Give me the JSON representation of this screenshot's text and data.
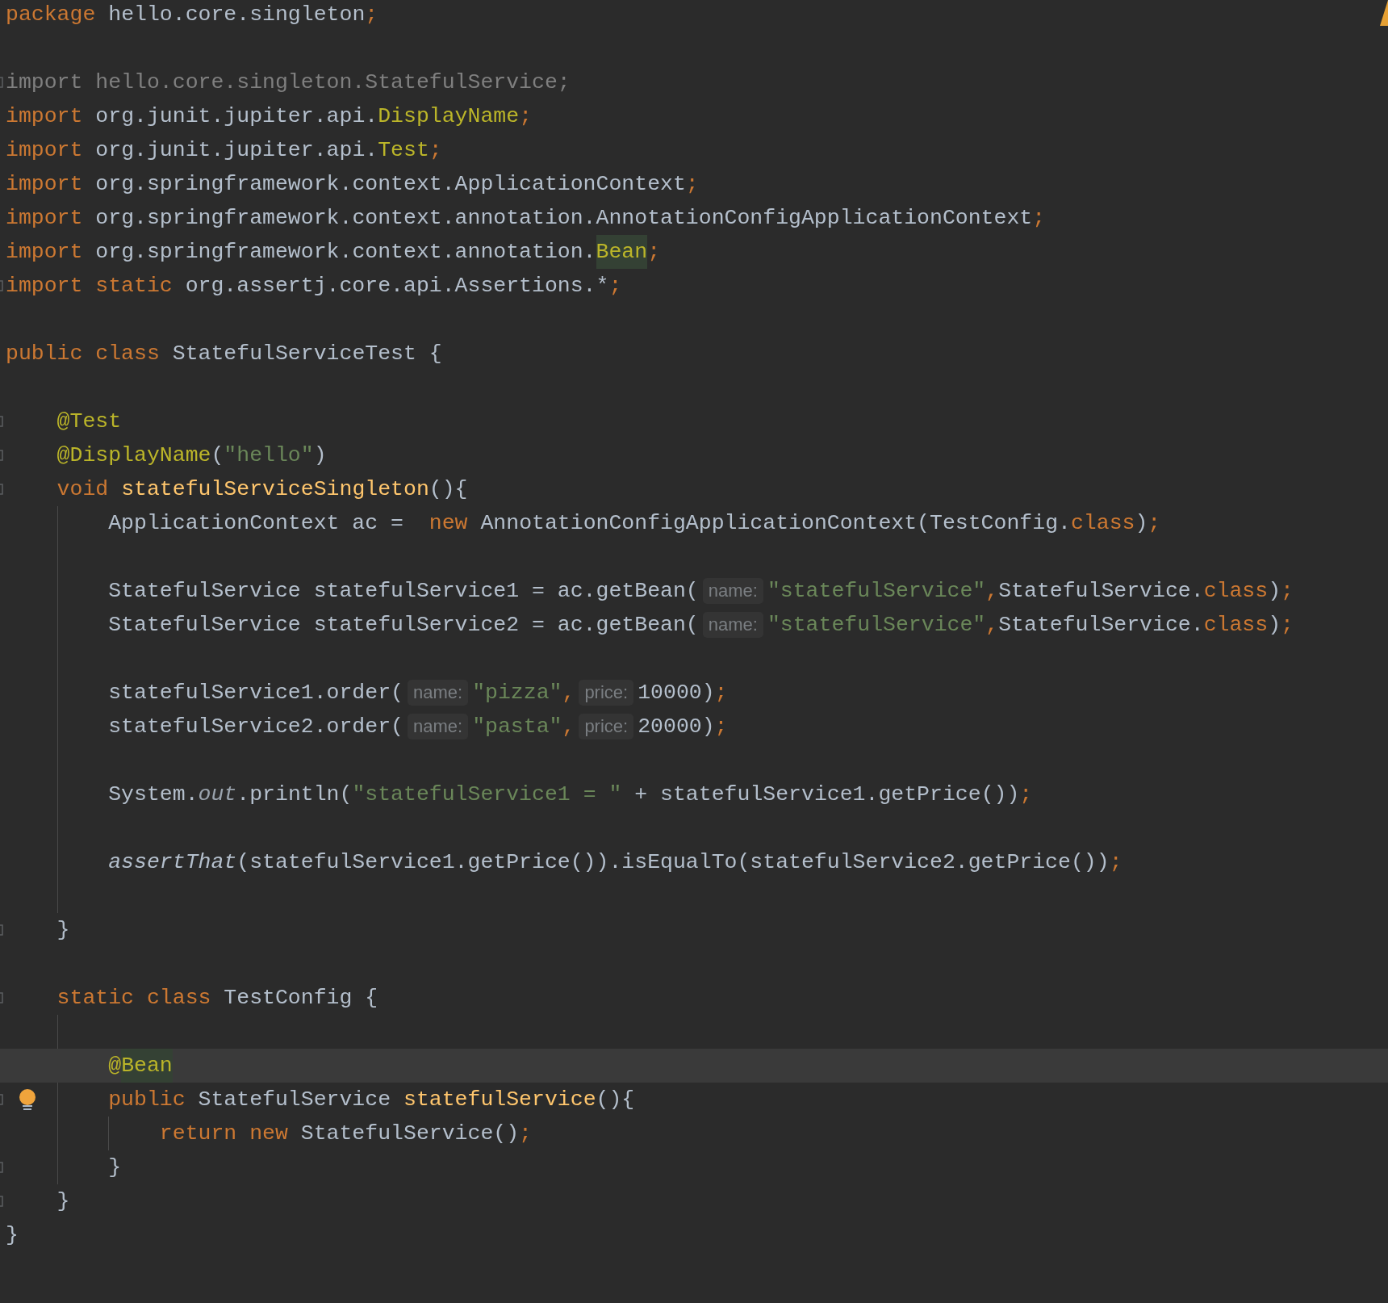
{
  "editor": {
    "warning_marker": true,
    "lines": [
      {
        "fold_marker": false,
        "lightbulb": false,
        "current": false,
        "tokens": [
          {
            "kind": "kw",
            "text": "package"
          },
          {
            "kind": "plain",
            "text": " hello.core.singleton"
          },
          {
            "kind": "kw",
            "text": ";"
          }
        ]
      },
      {
        "fold_marker": false,
        "lightbulb": false,
        "current": false
      },
      {
        "fold_marker": true,
        "lightbulb": false,
        "current": false,
        "tokens": [
          {
            "kind": "unused",
            "text": "import hello.core.singleton.StatefulService;"
          }
        ]
      },
      {
        "fold_marker": false,
        "lightbulb": false,
        "current": false,
        "tokens": [
          {
            "kind": "kw",
            "text": "import"
          },
          {
            "kind": "plain",
            "text": " org.junit.jupiter.api."
          },
          {
            "kind": "ann",
            "text": "DisplayName"
          },
          {
            "kind": "kw",
            "text": ";"
          }
        ]
      },
      {
        "fold_marker": false,
        "lightbulb": false,
        "current": false,
        "tokens": [
          {
            "kind": "kw",
            "text": "import"
          },
          {
            "kind": "plain",
            "text": " org.junit.jupiter.api."
          },
          {
            "kind": "ann",
            "text": "Test"
          },
          {
            "kind": "kw",
            "text": ";"
          }
        ]
      },
      {
        "fold_marker": false,
        "lightbulb": false,
        "current": false,
        "tokens": [
          {
            "kind": "kw",
            "text": "import"
          },
          {
            "kind": "plain",
            "text": " org.springframework.context.ApplicationContext"
          },
          {
            "kind": "kw",
            "text": ";"
          }
        ]
      },
      {
        "fold_marker": false,
        "lightbulb": false,
        "current": false,
        "tokens": [
          {
            "kind": "kw",
            "text": "import"
          },
          {
            "kind": "plain",
            "text": " org.springframework.context.annotation.AnnotationConfigApplicationContext"
          },
          {
            "kind": "kw",
            "text": ";"
          }
        ]
      },
      {
        "fold_marker": false,
        "lightbulb": false,
        "current": false,
        "tokens": [
          {
            "kind": "kw",
            "text": "import"
          },
          {
            "kind": "plain",
            "text": " org.springframework.context.annotation."
          },
          {
            "kind": "ann-hl",
            "text": "Bean"
          },
          {
            "kind": "kw",
            "text": ";"
          }
        ]
      },
      {
        "fold_marker": true,
        "lightbulb": false,
        "current": false,
        "tokens": [
          {
            "kind": "kw",
            "text": "import static"
          },
          {
            "kind": "plain",
            "text": " org.assertj.core.api.Assertions.*"
          },
          {
            "kind": "kw",
            "text": ";"
          }
        ]
      },
      {
        "fold_marker": false,
        "lightbulb": false,
        "current": false
      },
      {
        "fold_marker": false,
        "lightbulb": false,
        "current": false,
        "tokens": [
          {
            "kind": "kw",
            "text": "public class"
          },
          {
            "kind": "plain",
            "text": " StatefulServiceTest {"
          }
        ]
      },
      {
        "fold_marker": false,
        "lightbulb": false,
        "current": false
      },
      {
        "fold_marker": true,
        "lightbulb": false,
        "current": false,
        "indent": [
          false
        ],
        "tokens": [
          {
            "kind": "ann",
            "text": "@Test"
          }
        ]
      },
      {
        "fold_marker": true,
        "lightbulb": false,
        "current": false,
        "indent": [
          false
        ],
        "tokens": [
          {
            "kind": "ann",
            "text": "@DisplayName"
          },
          {
            "kind": "plain",
            "text": "("
          },
          {
            "kind": "str",
            "text": "\"hello\""
          },
          {
            "kind": "plain",
            "text": ")"
          }
        ]
      },
      {
        "fold_marker": true,
        "lightbulb": false,
        "current": false,
        "indent": [
          false
        ],
        "tokens": [
          {
            "kind": "kw",
            "text": "void"
          },
          {
            "kind": "fn",
            "text": " statefulServiceSingleton"
          },
          {
            "kind": "plain",
            "text": "(){"
          }
        ]
      },
      {
        "fold_marker": false,
        "lightbulb": false,
        "current": false,
        "indent": [
          false,
          true
        ],
        "tokens": [
          {
            "kind": "plain",
            "text": "ApplicationContext ac =  "
          },
          {
            "kind": "kw",
            "text": "new"
          },
          {
            "kind": "plain",
            "text": " AnnotationConfigApplicationContext(TestConfig."
          },
          {
            "kind": "kw",
            "text": "class"
          },
          {
            "kind": "plain",
            "text": ")"
          },
          {
            "kind": "kw",
            "text": ";"
          }
        ]
      },
      {
        "fold_marker": false,
        "lightbulb": false,
        "current": false,
        "indent": [
          false,
          true
        ]
      },
      {
        "fold_marker": false,
        "lightbulb": false,
        "current": false,
        "indent": [
          false,
          true
        ],
        "tokens": [
          {
            "kind": "plain",
            "text": "StatefulService statefulService1 = ac.getBean("
          },
          {
            "kind": "hint",
            "text": "name:"
          },
          {
            "kind": "str",
            "text": "\"statefulService\""
          },
          {
            "kind": "kw",
            "text": ","
          },
          {
            "kind": "plain",
            "text": "StatefulService."
          },
          {
            "kind": "kw",
            "text": "class"
          },
          {
            "kind": "plain",
            "text": ")"
          },
          {
            "kind": "kw",
            "text": ";"
          }
        ]
      },
      {
        "fold_marker": false,
        "lightbulb": false,
        "current": false,
        "indent": [
          false,
          true
        ],
        "tokens": [
          {
            "kind": "plain",
            "text": "StatefulService statefulService2 = ac.getBean("
          },
          {
            "kind": "hint",
            "text": "name:"
          },
          {
            "kind": "str",
            "text": "\"statefulService\""
          },
          {
            "kind": "kw",
            "text": ","
          },
          {
            "kind": "plain",
            "text": "StatefulService."
          },
          {
            "kind": "kw",
            "text": "class"
          },
          {
            "kind": "plain",
            "text": ")"
          },
          {
            "kind": "kw",
            "text": ";"
          }
        ]
      },
      {
        "fold_marker": false,
        "lightbulb": false,
        "current": false,
        "indent": [
          false,
          true
        ]
      },
      {
        "fold_marker": false,
        "lightbulb": false,
        "current": false,
        "indent": [
          false,
          true
        ],
        "tokens": [
          {
            "kind": "plain",
            "text": "statefulService1.order("
          },
          {
            "kind": "hint",
            "text": "name:"
          },
          {
            "kind": "str",
            "text": "\"pizza\""
          },
          {
            "kind": "kw",
            "text": ","
          },
          {
            "kind": "hint",
            "text": "price:"
          },
          {
            "kind": "plain",
            "text": "10000)"
          },
          {
            "kind": "kw",
            "text": ";"
          }
        ]
      },
      {
        "fold_marker": false,
        "lightbulb": false,
        "current": false,
        "indent": [
          false,
          true
        ],
        "tokens": [
          {
            "kind": "plain",
            "text": "statefulService2.order("
          },
          {
            "kind": "hint",
            "text": "name:"
          },
          {
            "kind": "str",
            "text": "\"pasta\""
          },
          {
            "kind": "kw",
            "text": ","
          },
          {
            "kind": "hint",
            "text": "price:"
          },
          {
            "kind": "plain",
            "text": "20000)"
          },
          {
            "kind": "kw",
            "text": ";"
          }
        ]
      },
      {
        "fold_marker": false,
        "lightbulb": false,
        "current": false,
        "indent": [
          false,
          true
        ]
      },
      {
        "fold_marker": false,
        "lightbulb": false,
        "current": false,
        "indent": [
          false,
          true
        ],
        "tokens": [
          {
            "kind": "plain",
            "text": "System."
          },
          {
            "kind": "field",
            "text": "out"
          },
          {
            "kind": "plain",
            "text": ".println("
          },
          {
            "kind": "str",
            "text": "\"statefulService1 = \""
          },
          {
            "kind": "plain",
            "text": " + statefulService1.getPrice())"
          },
          {
            "kind": "kw",
            "text": ";"
          }
        ]
      },
      {
        "fold_marker": false,
        "lightbulb": false,
        "current": false,
        "indent": [
          false,
          true
        ]
      },
      {
        "fold_marker": false,
        "lightbulb": false,
        "current": false,
        "indent": [
          false,
          true
        ],
        "tokens": [
          {
            "kind": "italic",
            "text": "assertThat"
          },
          {
            "kind": "plain",
            "text": "(statefulService1.getPrice()).isEqualTo(statefulService2.getPrice())"
          },
          {
            "kind": "kw",
            "text": ";"
          }
        ]
      },
      {
        "fold_marker": false,
        "lightbulb": false,
        "current": false,
        "indent": [
          false,
          true
        ]
      },
      {
        "fold_marker": true,
        "lightbulb": false,
        "current": false,
        "indent": [
          false
        ],
        "tokens": [
          {
            "kind": "plain",
            "text": "}"
          }
        ]
      },
      {
        "fold_marker": false,
        "lightbulb": false,
        "current": false
      },
      {
        "fold_marker": true,
        "lightbulb": false,
        "current": false,
        "indent": [
          false
        ],
        "tokens": [
          {
            "kind": "kw",
            "text": "static class"
          },
          {
            "kind": "plain",
            "text": " TestConfig {"
          }
        ]
      },
      {
        "fold_marker": false,
        "lightbulb": false,
        "current": false,
        "indent": [
          false,
          true
        ]
      },
      {
        "fold_marker": false,
        "lightbulb": false,
        "current": true,
        "indent": [
          false,
          false
        ],
        "tokens": [
          {
            "kind": "ann",
            "text": "@"
          },
          {
            "kind": "ann-hl",
            "text": "Bean"
          }
        ]
      },
      {
        "fold_marker": true,
        "lightbulb": true,
        "current": false,
        "indent": [
          false,
          true
        ],
        "tokens": [
          {
            "kind": "kw",
            "text": "public"
          },
          {
            "kind": "plain",
            "text": " StatefulService "
          },
          {
            "kind": "fn",
            "text": "statefulService"
          },
          {
            "kind": "plain",
            "text": "(){"
          }
        ]
      },
      {
        "fold_marker": false,
        "lightbulb": false,
        "current": false,
        "indent": [
          false,
          true,
          true
        ],
        "tokens": [
          {
            "kind": "kw",
            "text": "return new"
          },
          {
            "kind": "plain",
            "text": " StatefulService()"
          },
          {
            "kind": "kw",
            "text": ";"
          }
        ]
      },
      {
        "fold_marker": true,
        "lightbulb": false,
        "current": false,
        "indent": [
          false,
          true
        ],
        "tokens": [
          {
            "kind": "plain",
            "text": "}"
          }
        ]
      },
      {
        "fold_marker": true,
        "lightbulb": false,
        "current": false,
        "indent": [
          false
        ],
        "tokens": [
          {
            "kind": "plain",
            "text": "}"
          }
        ]
      },
      {
        "fold_marker": false,
        "lightbulb": false,
        "current": false,
        "tokens": [
          {
            "kind": "plain",
            "text": "}"
          }
        ]
      }
    ]
  }
}
